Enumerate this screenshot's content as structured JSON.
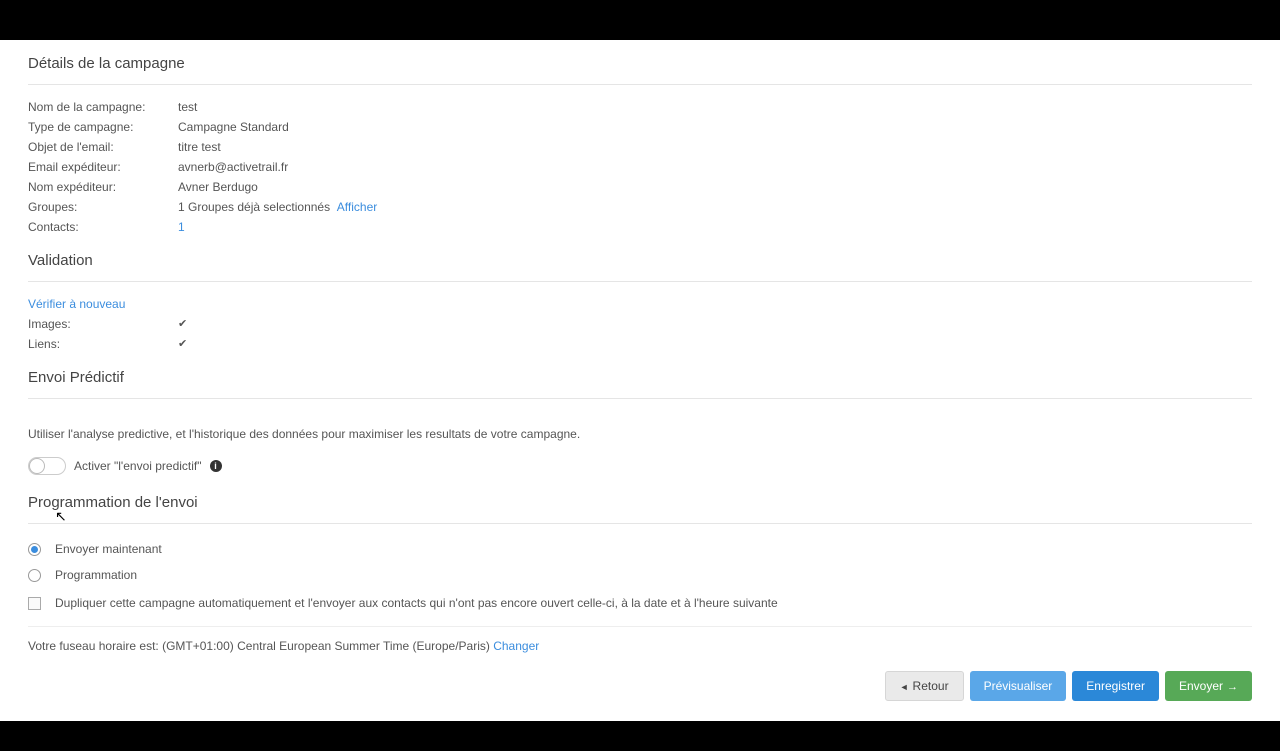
{
  "sections": {
    "details_title": "Détails de la campagne",
    "validation_title": "Validation",
    "predictive_title": "Envoi Prédictif",
    "schedule_title": "Programmation de l'envoi"
  },
  "details": {
    "name_label": "Nom de la campagne:",
    "name_value": "test",
    "type_label": "Type de campagne:",
    "type_value": "Campagne Standard",
    "subject_label": "Objet de l'email:",
    "subject_value": "titre test",
    "sender_email_label": "Email expéditeur:",
    "sender_email_value": "avnerb@activetrail.fr",
    "sender_name_label": "Nom expéditeur:",
    "sender_name_value": "Avner Berdugo",
    "groups_label": "Groupes:",
    "groups_value": "1 Groupes déjà selectionnés",
    "groups_link": "Afficher",
    "contacts_label": "Contacts:",
    "contacts_value": "1"
  },
  "validation": {
    "reverify_link": "Vérifier à nouveau",
    "images_label": "Images:",
    "links_label": "Liens:"
  },
  "predictive": {
    "description": "Utiliser l'analyse predictive, et l'historique des données pour maximiser les resultats de votre campagne.",
    "toggle_label": "Activer \"l'envoi predictif\""
  },
  "schedule": {
    "send_now": "Envoyer maintenant",
    "schedule_later": "Programmation",
    "duplicate_label": "Dupliquer cette campagne automatiquement et l'envoyer aux contacts qui n'ont pas encore ouvert celle-ci, à la date et à l'heure suivante",
    "timezone_prefix": "Votre fuseau horaire est: (GMT+01:00) Central European Summer Time (Europe/Paris)",
    "timezone_change": "Changer"
  },
  "footer": {
    "back": "Retour",
    "preview": "Prévisualiser",
    "save": "Enregistrer",
    "send": "Envoyer"
  }
}
